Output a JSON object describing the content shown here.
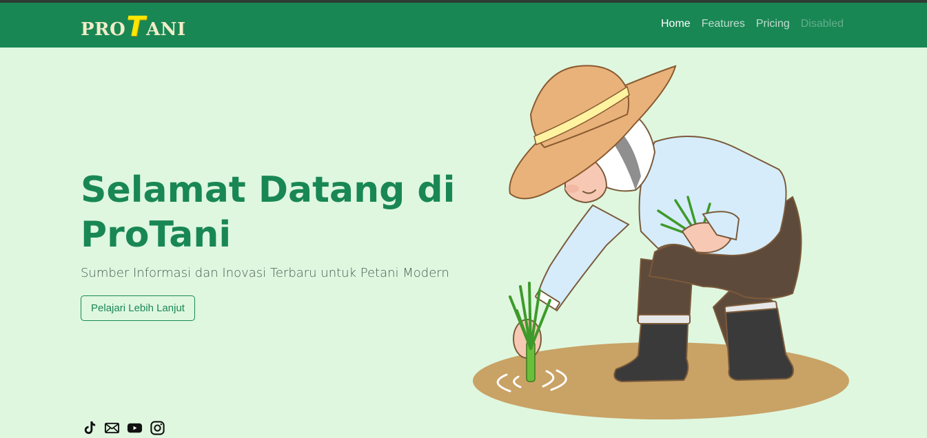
{
  "brand": {
    "part1": "PRO",
    "part2": "T",
    "part3": "ANI"
  },
  "nav": {
    "home": "Home",
    "features": "Features",
    "pricing": "Pricing",
    "disabled": "Disabled"
  },
  "hero": {
    "title": "Selamat Datang di ProTani",
    "subtitle": "Sumber Informasi dan Inovasi Terbaru untuk Petani Modern",
    "cta": "Pelajari Lebih Lanjut"
  },
  "socials": [
    "tiktok-icon",
    "mail-icon",
    "youtube-icon",
    "instagram-icon"
  ],
  "colors": {
    "primary": "#198754",
    "background": "#dff7df",
    "logo_accent": "#ffe600"
  }
}
